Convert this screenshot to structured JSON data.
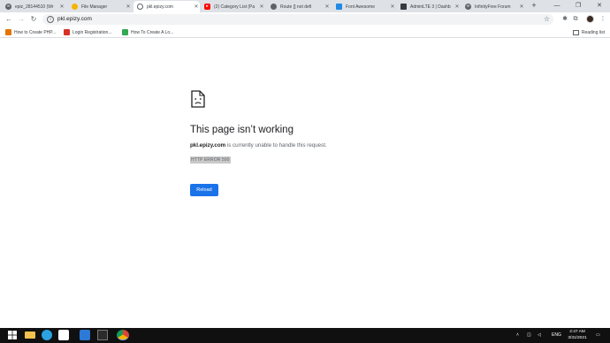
{
  "tabs": [
    {
      "label": "epiz_28144510 (Wr",
      "icon": "infinityfree-icon",
      "color": "#5f6368"
    },
    {
      "label": "File Manager",
      "icon": "filemanager-icon",
      "color": "#f4b400"
    },
    {
      "label": "pkl.epizy.com",
      "icon": "globe-icon",
      "color": "#5f6368",
      "active": true
    },
    {
      "label": "(2) Category List (Pa",
      "icon": "youtube-icon",
      "color": "#ff0000"
    },
    {
      "label": "Route [] not defi",
      "icon": "laravel-icon",
      "color": "#5f6368"
    },
    {
      "label": "Font Awesome",
      "icon": "fontawesome-icon",
      "color": "#228ae6"
    },
    {
      "label": "AdminLTE 3 | Dashb",
      "icon": "adminlte-icon",
      "color": "#343a40"
    },
    {
      "label": "InfinityFree Forum",
      "icon": "infinityfree-icon",
      "color": "#5f6368"
    }
  ],
  "toolbar": {
    "url": "pkl.epizy.com",
    "back_icon": "←",
    "forward_icon": "→",
    "reload_icon": "↻",
    "star_icon": "☆"
  },
  "bookmarks": [
    {
      "label": "How to Create PHP...",
      "color": "#e37400"
    },
    {
      "label": "Login Registration...",
      "color": "#d93025"
    },
    {
      "label": "How To Create A Lo...",
      "color": "#34a853"
    }
  ],
  "reading_list": "Reading list",
  "error": {
    "title": "This page isn’t working",
    "host": "pkl.epizy.com",
    "message": " is currently unable to handle this request.",
    "code": "HTTP ERROR 500",
    "reload_label": "Reload"
  },
  "taskbar": {
    "language": "ENG",
    "time": "2:47 AM",
    "date": "3/31/2021"
  },
  "colors": {
    "accent": "#1a73e8",
    "tabstrip": "#dee1e6",
    "taskbar": "#101010"
  }
}
